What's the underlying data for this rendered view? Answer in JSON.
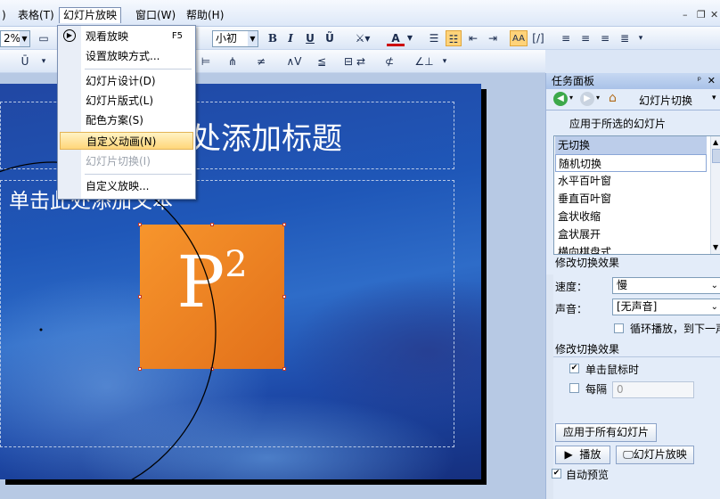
{
  "menubar": {
    "items": [
      {
        "label": ")"
      },
      {
        "label": "表格(T)"
      },
      {
        "label": "幻灯片放映"
      },
      {
        "label": "窗口(W)"
      },
      {
        "label": "帮助(H)"
      }
    ]
  },
  "toolbar": {
    "zoom": "2%",
    "font_size": "小初",
    "bold": "B",
    "italic": "I",
    "underline": "U",
    "strike": "Ũ",
    "font_color": "A",
    "row2": [
      "Ū",
      "⊨",
      "⋔",
      "≠",
      "∠",
      "∧V",
      "≦",
      "⊟",
      "⇄",
      "⊄",
      "∠⊥"
    ]
  },
  "dropdown": {
    "items": [
      {
        "label": "观看放映",
        "shortcut": "F5"
      },
      {
        "label": "设置放映方式..."
      },
      {
        "label": "幻灯片设计(D)"
      },
      {
        "label": "幻灯片版式(L)"
      },
      {
        "label": "配色方案(S)"
      },
      {
        "label": "自定义动画(N)"
      },
      {
        "label": "幻灯片切换(I)"
      },
      {
        "label": "自定义放映..."
      }
    ]
  },
  "slide": {
    "title_text": "处添加标题",
    "body_text": "单击此处添加文本",
    "logo_text": "P",
    "logo_sup": "2"
  },
  "taskpane": {
    "title": "任务面板",
    "nav_title": "幻灯片切换",
    "apply_selected": "应用于所选的幻灯片",
    "transitions": [
      "无切换",
      "随机切换",
      "水平百叶窗",
      "垂直百叶窗",
      "盒状收缩",
      "盒状展开",
      "横向棋盘式"
    ],
    "modify_effect": "修改切换效果",
    "speed_label": "速度：",
    "speed_value": "慢",
    "sound_label": "声音：",
    "sound_value": "[无声音]",
    "loop_label": "循环播放，到下一声",
    "advance_title": "修改切换效果",
    "on_click_label": "单击鼠标时",
    "every_label": "每隔",
    "every_value": "0",
    "apply_all": "应用于所有幻灯片",
    "play": "播放",
    "slideshow": "幻灯片放映",
    "auto_preview": "自动预览"
  },
  "colors": {
    "accent": "#f7952c",
    "menu_highlight": "#ffd67a"
  }
}
